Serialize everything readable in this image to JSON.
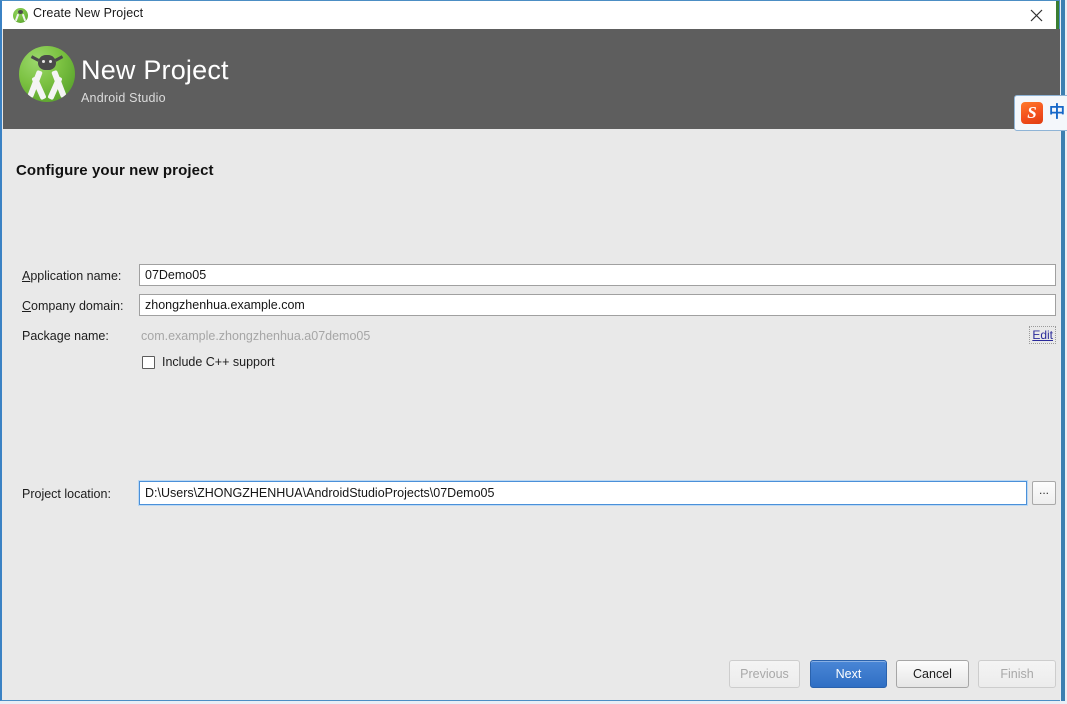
{
  "window": {
    "titlebar": {
      "title": "Create New Project",
      "app_icon": "android-studio-icon",
      "close_label": "close-icon"
    },
    "header": {
      "logo": "android-studio-logo",
      "title": "New Project",
      "subtitle": "Android Studio"
    }
  },
  "ime": {
    "logo_text": "S",
    "mode_text": "中",
    "name": "sogou-ime-toolbar"
  },
  "content": {
    "step_title": "Configure your new project",
    "fields": {
      "application_name": {
        "label": "Application name:",
        "mnemonic": "A",
        "value": "07Demo05"
      },
      "company_domain": {
        "label": "Company domain:",
        "mnemonic": "C",
        "value": "zhongzhenhua.example.com"
      },
      "package_name": {
        "label": "Package name:",
        "value": "com.example.zhongzhenhua.a07demo05",
        "edit_link": "Edit",
        "disabled": true
      },
      "include_cpp": {
        "label": "Include C++ support",
        "checked": false
      },
      "project_location": {
        "label": "Project location:",
        "value_before_caret": "D:",
        "value_after_caret": "\\Users\\ZHONGZHENHUA\\AndroidStudioProjects\\07Demo05",
        "full_value": "D:\\Users\\ZHONGZHENHUA\\AndroidStudioProjects\\07Demo05",
        "focused": true,
        "browse_label": "..."
      }
    }
  },
  "buttons": {
    "previous": {
      "label": "Previous",
      "state": "disabled"
    },
    "next": {
      "label": "Next",
      "state": "default"
    },
    "cancel": {
      "label": "Cancel",
      "state": "normal"
    },
    "finish": {
      "label": "Finish",
      "state": "disabled"
    }
  },
  "colors": {
    "header_bg": "#5e5e5e",
    "content_bg": "#e9e9e9",
    "accent_blue": "#2f6fc4",
    "link_blue": "#2a2a9a",
    "disabled_text": "#a6a6a6",
    "logo_green": "#7cc242",
    "ime_orange": "#f4511e",
    "window_border": "#3b82c4"
  }
}
